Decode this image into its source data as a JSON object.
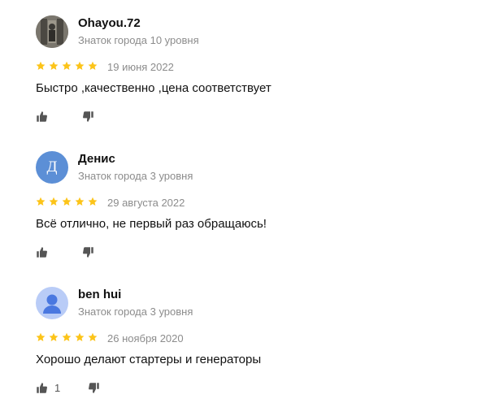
{
  "colors": {
    "star": "#fcc419",
    "muted": "#8c8c8c",
    "icon": "#555555"
  },
  "reviews": [
    {
      "name": "Ohayou.72",
      "level": "Знаток города 10 уровня",
      "avatar_type": "photo",
      "avatar_letter": "",
      "rating": 5,
      "date": "19 июня 2022",
      "text": "Быстро ,качественно ,цена соответствует",
      "likes": ""
    },
    {
      "name": "Денис",
      "level": "Знаток города 3 уровня",
      "avatar_type": "letter",
      "avatar_letter": "Д",
      "rating": 5,
      "date": "29 августа 2022",
      "text": "Всё отлично, не первый раз обращаюсь!",
      "likes": ""
    },
    {
      "name": "ben hui",
      "level": "Знаток города 3 уровня",
      "avatar_type": "generic",
      "avatar_letter": "",
      "rating": 5,
      "date": "26 ноября 2020",
      "text": "Хорошо делают стартеры и генераторы",
      "likes": "1"
    }
  ]
}
